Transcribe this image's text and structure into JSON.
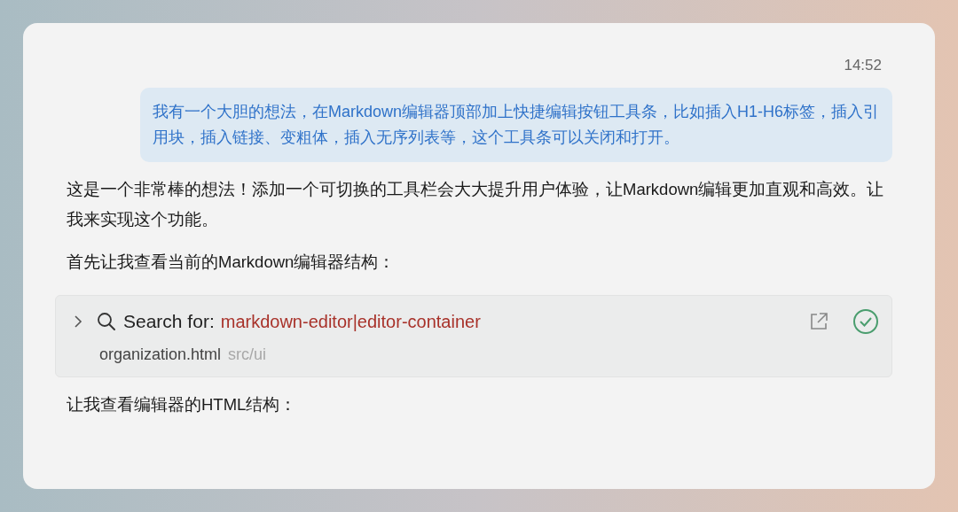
{
  "user_message": {
    "time": "14:52",
    "text": "我有一个大胆的想法，在Markdown编辑器顶部加上快捷编辑按钮工具条，比如插入H1-H6标签，插入引用块，插入链接、变粗体，插入无序列表等，这个工具条可以关闭和打开。"
  },
  "paragraphs": [
    "这是一个非常棒的想法！添加一个可切换的工具栏会大大提升用户体验，让Markdown编辑更加直观和高效。让我来实现这个功能。",
    "首先让我查看当前的Markdown编辑器结构："
  ],
  "tool_call": {
    "expanded": false,
    "completed": true,
    "label": "Search for:",
    "query": "markdown-editor|editor-container",
    "file": "organization.html",
    "path": "src/ui"
  },
  "closing_paragraph": "让我查看编辑器的HTML结构："
}
